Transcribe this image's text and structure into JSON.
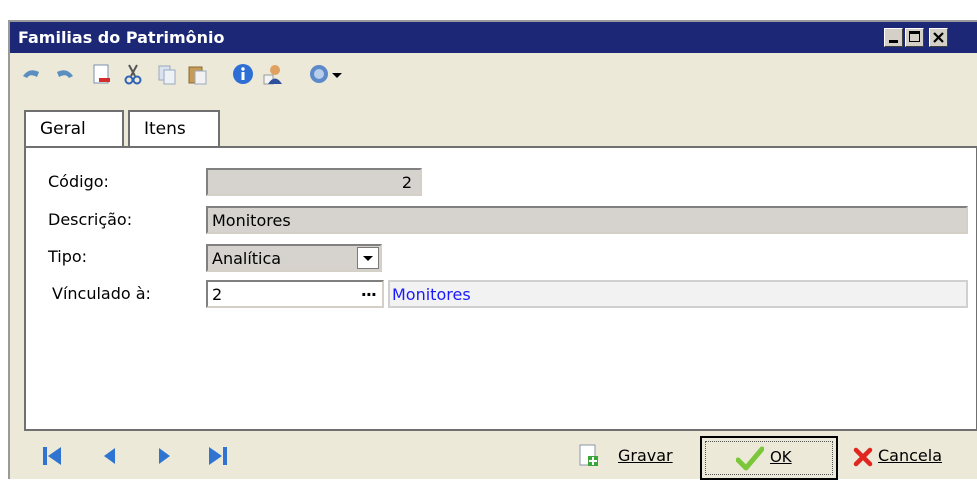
{
  "window": {
    "title": "Familias do Patrimônio"
  },
  "toolbar": {
    "items": [
      "undo-icon",
      "redo-icon",
      "new-document-icon",
      "cut-icon",
      "copy-icon",
      "paste-icon",
      "info-icon",
      "user-icon",
      "help-icon",
      "dropdown-arrow-icon"
    ]
  },
  "tabs": [
    {
      "label": "Geral",
      "active": true
    },
    {
      "label": "Itens",
      "active": false
    }
  ],
  "form": {
    "codigo": {
      "label": "Código:",
      "value": "2"
    },
    "descricao": {
      "label": "Descrição:",
      "value": "Monitores"
    },
    "tipo": {
      "label": "Tipo:",
      "value": "Analítica"
    },
    "vinculado": {
      "label": "Vínculado à:",
      "value": "2",
      "ellipsis": "···",
      "description": "Monitores"
    }
  },
  "footer": {
    "save_label": "Gravar",
    "ok_label": "OK",
    "cancel_label": "Cancela"
  },
  "colors": {
    "titlebar": "#1c2876",
    "link_text": "#1a1aff",
    "window_bg": "#ece9d8"
  }
}
